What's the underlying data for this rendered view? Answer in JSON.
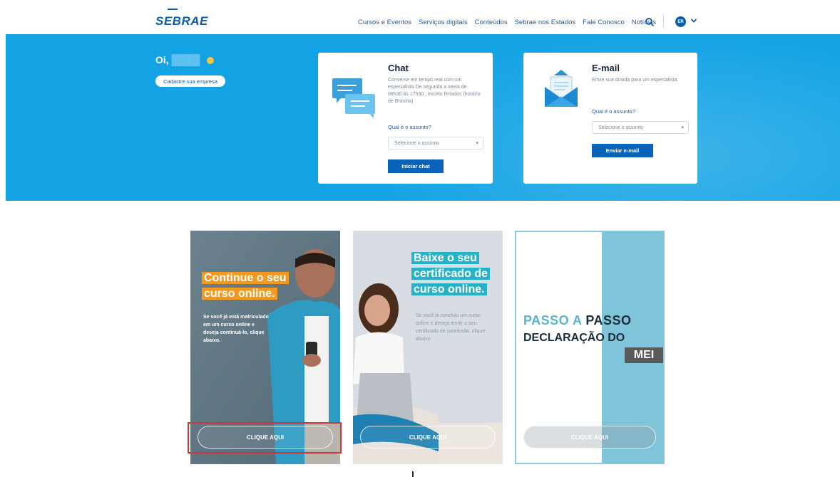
{
  "header": {
    "logo": "SEBRAE",
    "nav": [
      "Cursos e Eventos",
      "Serviços digitais",
      "Conteúdos",
      "Sebrae nos Estados",
      "Fale Conosco",
      "Notícias"
    ],
    "avatar_initials": "ER"
  },
  "banner": {
    "greeting": "Oi,",
    "register_label": "Cadastre sua empresa"
  },
  "chat": {
    "title": "Chat",
    "desc": "Converse em tempo real com um especialista De segunda a sexta de 08h30 às 17h30 , exceto feriados (horário de Brasília)",
    "question": "Qual é o assunto?",
    "select_placeholder": "Selecione o assunto",
    "button": "Iniciar chat"
  },
  "mail": {
    "title": "E-mail",
    "desc": "Envie sua dúvida para um especialista",
    "question": "Qual é o assunto?",
    "select_placeholder": "Selecione o assunto",
    "button": "Enviar e-mail"
  },
  "promos": [
    {
      "line1": "Continue o seu",
      "line2": "curso online.",
      "text": "Se você já está matriculado em um curso online e deseja continuá-lo, clique abaixo.",
      "cta": "CLIQUE AQUI"
    },
    {
      "line1": "Baixe o seu",
      "line2": "certificado de",
      "line3": "curso online.",
      "text": "Se você já concluiu um curso online e deseja emitir o seu certificado de conclusão, clique abaixo.",
      "cta": "CLIQUE AQUI"
    },
    {
      "line1a": "PASSO A",
      "line1b": "PASSO",
      "line2": "DECLARAÇÃO DO",
      "line3": "MEI",
      "cta": "CLIQUE AQUI"
    }
  ],
  "colors": {
    "banner": "#13a3e4",
    "brand": "#0a5ba8",
    "button": "#0a63b8",
    "orange": "#f39a1e",
    "teal": "#27b3c7",
    "highlight": "#d0363b"
  }
}
